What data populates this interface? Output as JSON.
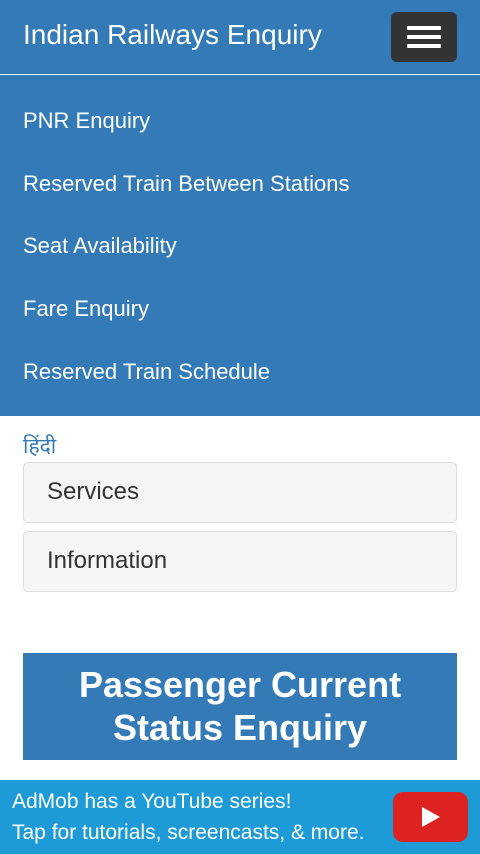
{
  "navbar": {
    "brand": "Indian Railways Enquiry",
    "toggle_icon": "hamburger-menu-icon"
  },
  "menu": {
    "items": [
      {
        "label": "PNR Enquiry"
      },
      {
        "label": "Reserved Train Between Stations"
      },
      {
        "label": "Seat Availability"
      },
      {
        "label": "Fare Enquiry"
      },
      {
        "label": "Reserved Train Schedule"
      }
    ]
  },
  "main": {
    "language_link": "हिंदी",
    "panels": [
      {
        "title": "Services"
      },
      {
        "title": "Information"
      }
    ],
    "banner": {
      "line1": "Passenger Current",
      "line2": "Status Enquiry"
    }
  },
  "ad": {
    "line1": "AdMob has a YouTube series!",
    "line2": "Tap for tutorials, screencasts, & more.",
    "icon": "youtube-play-icon"
  },
  "colors": {
    "primary": "#337ab7",
    "toggle": "#333333",
    "ad_background": "#1e9bd7",
    "youtube_red": "#dd2222"
  }
}
